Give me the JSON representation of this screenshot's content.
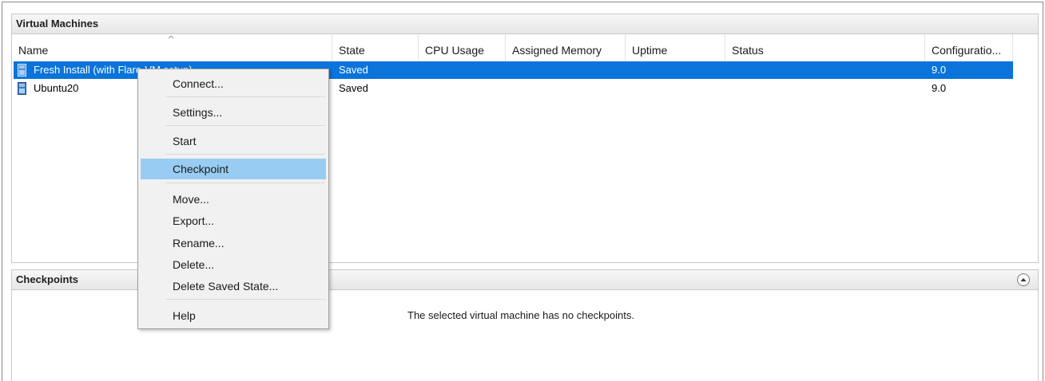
{
  "vm_panel": {
    "title": "Virtual Machines"
  },
  "columns": [
    "Name",
    "State",
    "CPU Usage",
    "Assigned Memory",
    "Uptime",
    "Status",
    "Configuratio..."
  ],
  "rows": [
    {
      "name": "Fresh Install (with Flare-VM setup)",
      "state": "Saved",
      "cpu": "",
      "memory": "",
      "uptime": "",
      "status": "",
      "config": "9.0",
      "selected": true
    },
    {
      "name": "Ubuntu20",
      "state": "Saved",
      "cpu": "",
      "memory": "",
      "uptime": "",
      "status": "",
      "config": "9.0",
      "selected": false
    }
  ],
  "context_menu": {
    "items": [
      "Connect...",
      "Settings...",
      "Start",
      "Checkpoint",
      "Move...",
      "Export...",
      "Rename...",
      "Delete...",
      "Delete Saved State...",
      "Help"
    ],
    "highlighted": "Checkpoint"
  },
  "checkpoints_panel": {
    "title": "Checkpoints",
    "empty_message": "The selected virtual machine has no checkpoints."
  },
  "colors": {
    "selection": "#0a74da",
    "menu_highlight": "#99ccf2"
  },
  "icons": {
    "vm": "virtual-machine-icon",
    "collapse": "chevron-up-icon"
  }
}
